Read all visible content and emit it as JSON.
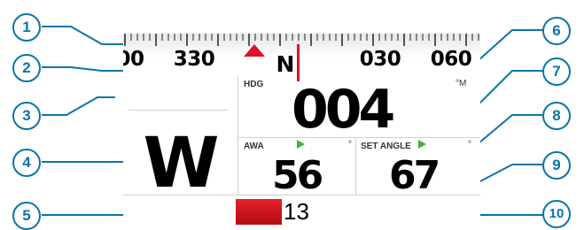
{
  "compass": {
    "labels": [
      "00",
      "330",
      "030",
      "060"
    ],
    "north": "N"
  },
  "panels": {
    "left_value": "W",
    "heading": {
      "label": "HDG",
      "unit": "°M",
      "value": "004"
    },
    "awa": {
      "label": "AWA",
      "unit": "°",
      "value": "56"
    },
    "set_angle": {
      "label": "SET ANGLE",
      "unit": "°",
      "value": "67"
    },
    "bottom_value": "13"
  },
  "callouts": [
    "1",
    "2",
    "3",
    "4",
    "5",
    "6",
    "7",
    "8",
    "9",
    "10"
  ],
  "colors": {
    "accent_blue": "#0a75a8",
    "marker_red": "#e0102a",
    "indicator_green": "#3cb43c"
  }
}
